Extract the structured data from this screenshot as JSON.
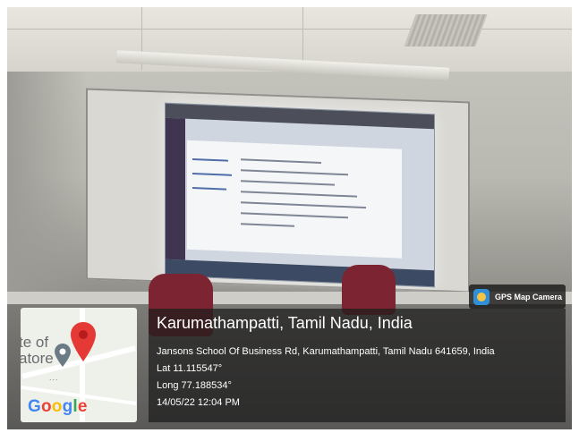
{
  "camera_badge": {
    "label": "GPS Map Camera",
    "icon": "gps-map-camera-icon"
  },
  "location": {
    "title": "Karumathampatti, Tamil Nadu, India",
    "address": "Jansons School Of Business Rd, Karumathampatti, Tamil Nadu 641659, India",
    "lat": "Lat 11.115547°",
    "long": "Long 77.188534°",
    "datetime": "14/05/22 12:04 PM"
  },
  "map": {
    "partial_text_1": "te of",
    "partial_text_2": "atore",
    "dots": "...",
    "attribution": "Google",
    "pin_color": "#e53935",
    "gray_pin_color": "#6b7b86"
  },
  "colors": {
    "overlay": "#1c1c1c",
    "text": "#ffffff",
    "google_blue": "#4285F4",
    "google_red": "#EA4335",
    "google_yellow": "#FBBC05",
    "google_green": "#34A853"
  }
}
